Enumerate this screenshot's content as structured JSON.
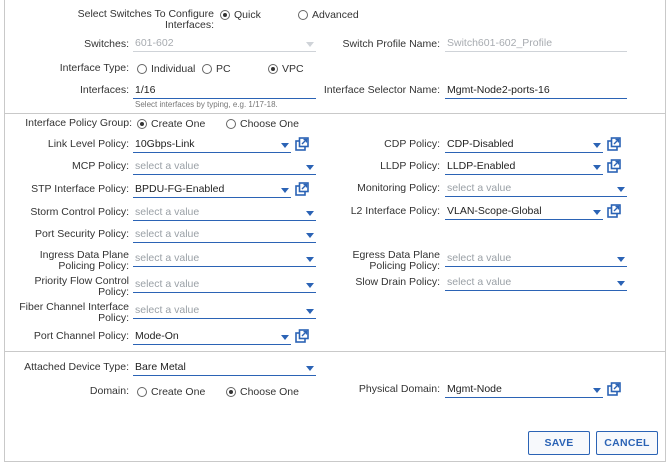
{
  "top": {
    "select_label": "Select Switches To Configure Interfaces:",
    "mode_options": [
      "Quick",
      "Advanced"
    ],
    "switches_label": "Switches:",
    "switches_value": "601-602",
    "profile_label": "Switch Profile Name:",
    "profile_value": "Switch601-602_Profile",
    "interface_type_label": "Interface Type:",
    "interface_types": [
      "Individual",
      "PC",
      "VPC"
    ],
    "interfaces_label": "Interfaces:",
    "interfaces_value": "1/16",
    "interfaces_hint": "Select interfaces by typing, e.g. 1/17-18.",
    "selector_label": "Interface Selector Name:",
    "selector_value": "Mgmt-Node2-ports-16"
  },
  "policy": {
    "group_label": "Interface Policy Group:",
    "group_options": [
      "Create One",
      "Choose One"
    ],
    "placeholder": "select a value",
    "link_level_label": "Link Level Policy:",
    "link_level_value": "10Gbps-Link",
    "cdp_label": "CDP Policy:",
    "cdp_value": "CDP-Disabled",
    "mcp_label": "MCP Policy:",
    "lldp_label": "LLDP Policy:",
    "lldp_value": "LLDP-Enabled",
    "stp_label": "STP Interface Policy:",
    "stp_value": "BPDU-FG-Enabled",
    "monitoring_label": "Monitoring Policy:",
    "storm_label": "Storm Control Policy:",
    "l2_label": "L2 Interface Policy:",
    "l2_value": "VLAN-Scope-Global",
    "port_security_label": "Port Security Policy:",
    "ingress_label_1": "Ingress Data Plane",
    "ingress_label_2": "Policing Policy:",
    "egress_label_1": "Egress Data Plane",
    "egress_label_2": "Policing Policy:",
    "pfc_label_1": "Priority Flow Control",
    "pfc_label_2": "Policy:",
    "slow_drain_label": "Slow Drain Policy:",
    "fiber_label_1": "Fiber Channel Interface",
    "fiber_label_2": "Policy:",
    "port_channel_label": "Port Channel Policy:",
    "port_channel_value": "Mode-On"
  },
  "device": {
    "attached_label": "Attached Device Type:",
    "attached_value": "Bare Metal",
    "domain_label": "Domain:",
    "domain_options": [
      "Create One",
      "Choose One"
    ],
    "physical_label": "Physical Domain:",
    "physical_value": "Mgmt-Node"
  },
  "buttons": {
    "save": "SAVE",
    "cancel": "CANCEL"
  },
  "colors": {
    "accent": "#2b63b5",
    "border": "#c9c9c9"
  },
  "icons": {
    "external": "open-external-icon",
    "caret": "chevron-down-icon"
  }
}
